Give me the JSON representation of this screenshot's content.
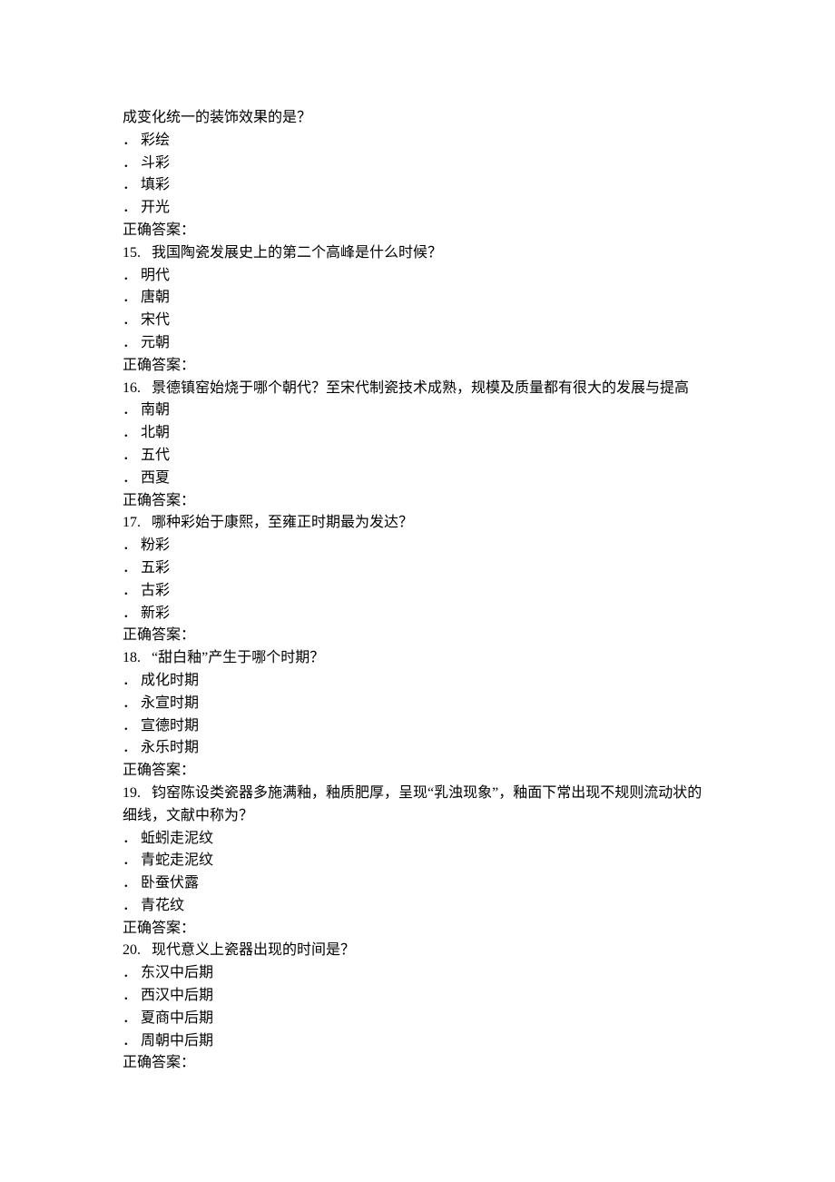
{
  "page": {
    "leading_fragment": "成变化统一的装饰效果的是？",
    "questions": [
      {
        "num": "",
        "text": "成变化统一的装饰效果的是？",
        "options": [
          "彩绘",
          "斗彩",
          "填彩",
          "开光"
        ],
        "answer_label": "正确答案："
      },
      {
        "num": "15.",
        "text": "我国陶瓷发展史上的第二个高峰是什么时候？",
        "options": [
          "明代",
          "唐朝",
          "宋代",
          "元朝"
        ],
        "answer_label": "正确答案："
      },
      {
        "num": "16.",
        "text": "景德镇窑始烧于哪个朝代？至宋代制瓷技术成熟，规模及质量都有很大的发展与提高",
        "options": [
          "南朝",
          "北朝",
          "五代",
          "西夏"
        ],
        "answer_label": "正确答案："
      },
      {
        "num": "17.",
        "text": "哪种彩始于康熙，至雍正时期最为发达？",
        "options": [
          "粉彩",
          "五彩",
          "古彩",
          "新彩"
        ],
        "answer_label": "正确答案："
      },
      {
        "num": "18.",
        "text": "“甜白釉”产生于哪个时期？",
        "options": [
          "成化时期",
          "永宣时期",
          "宣德时期",
          "永乐时期"
        ],
        "answer_label": "正确答案："
      },
      {
        "num": "19.",
        "text": "钧窑陈设类瓷器多施满釉，釉质肥厚，呈现“乳浊现象”，釉面下常出现不规则流动状的细线，文献中称为？",
        "options": [
          "蚯蚓走泥纹",
          "青蛇走泥纹",
          "卧蚕伏露",
          "青花纹"
        ],
        "answer_label": "正确答案："
      },
      {
        "num": "20.",
        "text": "现代意义上瓷器出现的时间是？",
        "options": [
          "东汉中后期",
          "西汉中后期",
          "夏商中后期",
          "周朝中后期"
        ],
        "answer_label": "正确答案："
      }
    ],
    "option_prefix": "．"
  }
}
